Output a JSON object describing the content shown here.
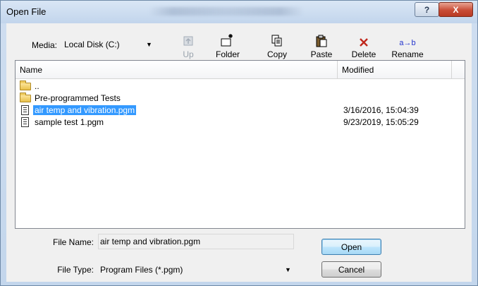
{
  "window": {
    "title": "Open File"
  },
  "toolbar": {
    "media_label": "Media:",
    "media_value": "Local Disk (C:)",
    "tools": [
      {
        "label": "Up",
        "icon": "up-folder-icon",
        "enabled": false
      },
      {
        "label": "Folder",
        "icon": "new-folder-icon",
        "enabled": true
      },
      {
        "label": "Copy",
        "icon": "copy-icon",
        "enabled": true
      },
      {
        "label": "Paste",
        "icon": "paste-icon",
        "enabled": true
      },
      {
        "label": "Delete",
        "icon": "delete-icon",
        "enabled": true
      },
      {
        "label": "Rename",
        "icon": "rename-icon",
        "enabled": true,
        "glyph": "a→b"
      }
    ]
  },
  "list": {
    "columns": {
      "name": "Name",
      "modified": "Modified"
    },
    "rows": [
      {
        "type": "folder",
        "name": "..",
        "modified": ""
      },
      {
        "type": "folder",
        "name": "Pre-programmed Tests",
        "modified": ""
      },
      {
        "type": "file",
        "name": "air temp and vibration.pgm",
        "modified": "3/16/2016, 15:04:39",
        "selected": true
      },
      {
        "type": "file",
        "name": "sample test 1.pgm",
        "modified": "9/23/2019, 15:05:29"
      }
    ]
  },
  "form": {
    "file_name_label": "File Name:",
    "file_name_value": "air temp and vibration.pgm",
    "file_type_label": "File Type:",
    "file_type_value": "Program Files (*.pgm)"
  },
  "buttons": {
    "open": "Open",
    "cancel": "Cancel"
  },
  "titlebar_buttons": {
    "help": "?",
    "close": "X"
  },
  "colors": {
    "selection": "#3399ff",
    "delete_icon": "#c0281c",
    "rename_icon": "#2233cc"
  }
}
